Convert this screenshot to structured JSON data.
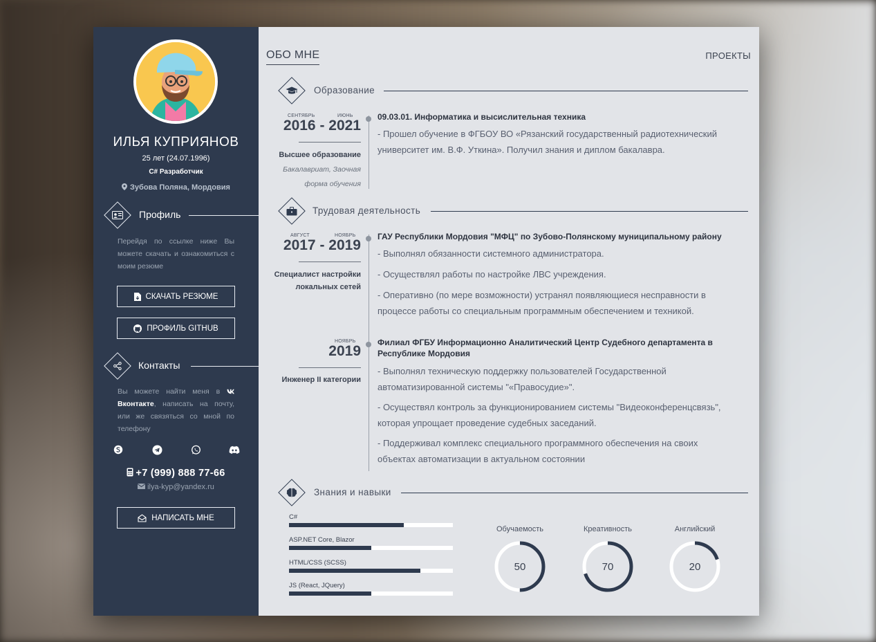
{
  "profile": {
    "name": "ИЛЬЯ КУПРИЯНОВ",
    "age": "25 лет (24.07.1996)",
    "role": "C# Разработчик",
    "location": "Зубова Поляна, Мордовия"
  },
  "sidebar": {
    "profile_title": "Профиль",
    "profile_text": "Перейдя по ссылке ниже Вы можете скачать и ознакомиться с моим резюме",
    "download_label": "СКАЧАТЬ РЕЗЮМЕ",
    "github_label": "ПРОФИЛЬ GITHUB",
    "contacts_title": "Контакты",
    "contacts_text_before": "Вы можете найти меня в",
    "contacts_vk": "Вконтакте",
    "contacts_text_after": ", написать на почту, или же связяться со мной по телефону",
    "phone": "+7 (999) 888 77-66",
    "email": "ilya-kyp@yandex.ru",
    "write_label": "НАПИСАТЬ МНЕ",
    "social_icons": [
      "skype-icon",
      "telegram-icon",
      "whatsapp-icon",
      "discord-icon"
    ]
  },
  "tabs": {
    "about": "ОБО МНЕ",
    "projects": "ПРОЕКТЫ"
  },
  "education": {
    "title": "Образование",
    "entries": [
      {
        "from_month": "СЕНТЯБРЬ",
        "to_month": "ИЮНЬ",
        "years": "2016 - 2021",
        "degree": "Высшее образование",
        "degree_sub_1": "Бакалавриат, Заочная",
        "degree_sub_2": "форма обучения",
        "heading": "09.03.01. Информатика и высислительная техника",
        "text_1": "- Прошел обучение в ФГБОУ ВО «Рязанский государственный радиотехнический",
        "text_2": "университет им. В.Ф. Уткина». Получил знания и диплом бакалавра."
      }
    ]
  },
  "work": {
    "title": "Трудовая деятельность",
    "entries": [
      {
        "from_month": "АВГУСТ",
        "to_month": "НОЯБРЬ",
        "years": "2017 - 2019",
        "position_1": "Специалист настройки",
        "position_2": "локальных сетей",
        "heading": "ГАУ Республики Мордовия \"МФЦ\" по Зубово-Полянскому муниципальному району",
        "bullets": [
          "- Выполнял обязанности системного администратора.",
          "- Осуществлял работы по настройке ЛВС учреждения.",
          "- Оперативно (по мере возможности) устранял появляющиеся несправности в",
          "процессе работы со специальным программным обеспечением и техникой."
        ]
      },
      {
        "to_month": "НОЯБРЬ",
        "years": "2019",
        "position_1": "Инженер II категории",
        "heading_1": "Филиал ФГБУ Информационно Аналитический Центр Судебного департамента в",
        "heading_2": "Республике Мордовия",
        "bullets": [
          "- Выполнял техническую поддержку пользователей Государственной",
          "автоматизированной системы \"«Правосудие»\".",
          "- Осуществял контроль за функционированием системы \"Видеоконференцсвязь\",",
          "которая упрощает проведение судебных заседаний.",
          "- Поддерживал комплекс специального программного обеспечения на своих",
          "объектах автоматизации в актуальном состоянии"
        ]
      }
    ]
  },
  "skills": {
    "title": "Знания и навыки",
    "bars": [
      {
        "label": "C#",
        "level": 0.7
      },
      {
        "label": "ASP.NET Core, Blazor",
        "level": 0.5
      },
      {
        "label": "HTML/CSS (SCSS)",
        "level": 0.8
      },
      {
        "label": "JS (React, JQuery)",
        "level": 0.5
      }
    ],
    "rings": [
      {
        "label": "Обучаемость",
        "value": 50
      },
      {
        "label": "Креативность",
        "value": 70
      },
      {
        "label": "Английский",
        "value": 20
      }
    ]
  },
  "colors": {
    "sidebar": "#2e3a4e",
    "main": "#e2e4e8",
    "accent": "#2e3a4e"
  }
}
